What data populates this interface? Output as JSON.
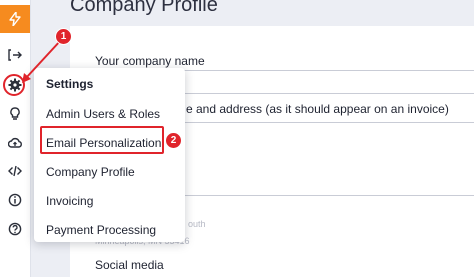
{
  "page": {
    "title": "Company Profile"
  },
  "form": {
    "company_name_label": "Your company name",
    "address_label_visible": "e and address (as it should appear on an invoice)",
    "address_line_faded_1": "outh",
    "address_line_faded_2": "Minneapolis, MN 55416",
    "social_label": "Social media"
  },
  "sidebar": {
    "icons": [
      "logo-icon",
      "logout-icon",
      "settings-icon",
      "lightbulb-icon",
      "cloud-upload-icon",
      "code-icon",
      "info-icon",
      "help-icon"
    ]
  },
  "settings_menu": {
    "header": "Settings",
    "items": [
      {
        "label": "Admin Users & Roles"
      },
      {
        "label": "Email Personalization"
      },
      {
        "label": "Company Profile"
      },
      {
        "label": "Invoicing"
      },
      {
        "label": "Payment Processing"
      }
    ]
  },
  "annotations": {
    "step_1": "1",
    "step_2": "2",
    "color": "#e0242b"
  },
  "colors": {
    "brand": "#f68b1f",
    "background": "#eceef4"
  }
}
